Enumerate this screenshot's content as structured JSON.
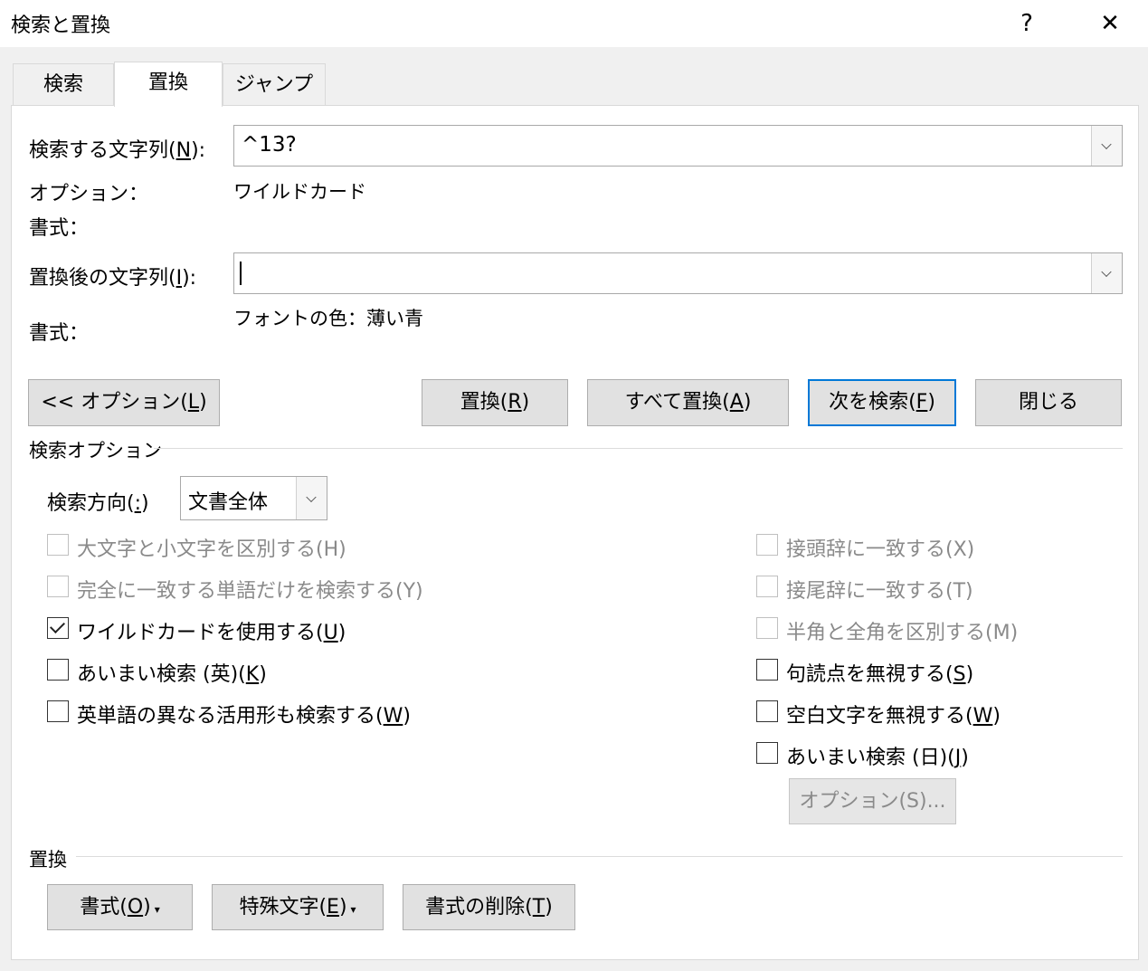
{
  "window": {
    "title": "検索と置換",
    "help_label": "?",
    "close_label": "✕"
  },
  "tabs": [
    {
      "label": "検索"
    },
    {
      "label": "置換"
    },
    {
      "label": "ジャンプ"
    }
  ],
  "find": {
    "label_prefix": "検索する文字列(",
    "label_key": "N",
    "label_suffix": "):",
    "value": "^13?",
    "options_label": "オプション：",
    "options_value": "ワイルドカード",
    "format_label": "書式："
  },
  "replace": {
    "label_prefix": "置換後の文字列(",
    "label_key": "I",
    "label_suffix": "):",
    "value": "",
    "format_label": "書式：",
    "format_value": "フォントの色：薄い青"
  },
  "buttons": {
    "options": {
      "prefix": "<< オプション(",
      "key": "L",
      "suffix": ")"
    },
    "replace": {
      "prefix": "置換(",
      "key": "R",
      "suffix": ")"
    },
    "replace_all": {
      "prefix": "すべて置換(",
      "key": "A",
      "suffix": ")"
    },
    "find_next": {
      "prefix": "次を検索(",
      "key": "F",
      "suffix": ")"
    },
    "close": {
      "label": "閉じる"
    }
  },
  "search_options": {
    "group_label": "検索オプション",
    "direction_prefix": "検索方向(",
    "direction_key": ":",
    "direction_suffix": ")",
    "direction_value": "文書全体",
    "left": [
      {
        "prefix": "大文字と小文字を区別する(H)",
        "key": "",
        "suffix": ""
      },
      {
        "prefix": "完全に一致する単語だけを検索する(Y)",
        "key": "",
        "suffix": ""
      },
      {
        "prefix": "ワイルドカードを使用する(",
        "key": "U",
        "suffix": ")"
      },
      {
        "prefix": "あいまい検索 (英)(",
        "key": "K",
        "suffix": ")"
      },
      {
        "prefix": "英単語の異なる活用形も検索する(",
        "key": "W",
        "suffix": ")"
      }
    ],
    "right": [
      {
        "prefix": "接頭辞に一致する(X)",
        "key": "",
        "suffix": ""
      },
      {
        "prefix": "接尾辞に一致する(T)",
        "key": "",
        "suffix": ""
      },
      {
        "prefix": "半角と全角を区別する(M)",
        "key": "",
        "suffix": ""
      },
      {
        "prefix": "句読点を無視する(",
        "key": "S",
        "suffix": ")"
      },
      {
        "prefix": "空白文字を無視する(",
        "key": "W",
        "suffix": ")"
      },
      {
        "prefix": "あいまい検索 (日)(",
        "key": "J",
        "suffix": ")"
      }
    ],
    "fuzzy_options_button": "オプション(S)..."
  },
  "replace_group": {
    "group_label": "置換",
    "format_btn": {
      "prefix": "書式(",
      "key": "O",
      "suffix": ")"
    },
    "special_btn": {
      "prefix": "特殊文字(",
      "key": "E",
      "suffix": ")"
    },
    "clear_btn": {
      "prefix": "書式の削除(",
      "key": "T",
      "suffix": ")"
    },
    "dropdown_glyph": "▾"
  }
}
